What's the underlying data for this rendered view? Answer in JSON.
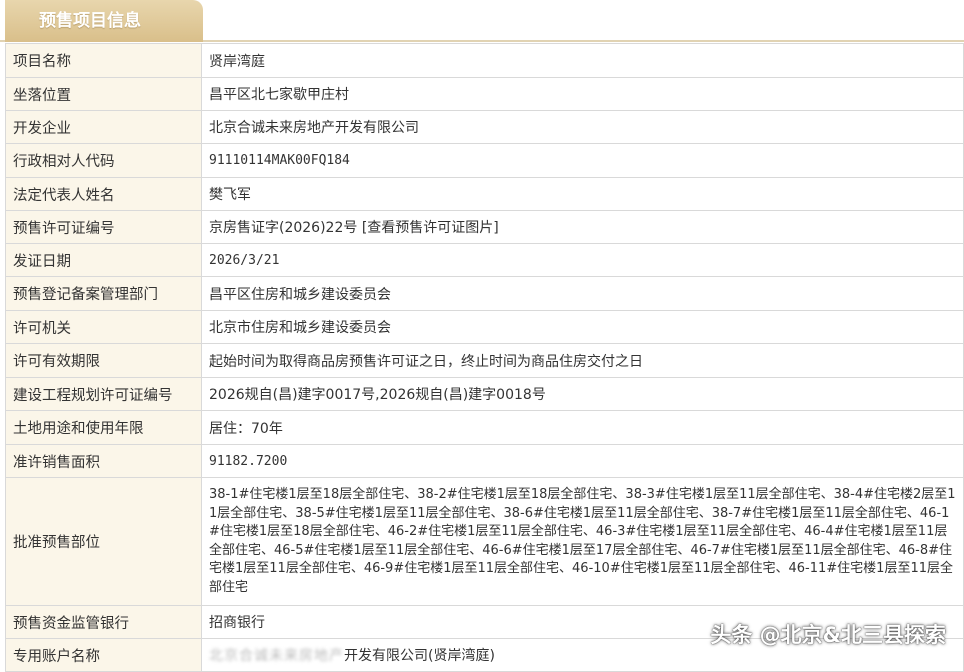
{
  "header": {
    "tab_title": "预售项目信息"
  },
  "rows": [
    {
      "label": "项目名称",
      "value": "贤岸湾庭"
    },
    {
      "label": "坐落位置",
      "value": "昌平区北七家歇甲庄村"
    },
    {
      "label": "开发企业",
      "value": "北京合诚未来房地产开发有限公司"
    },
    {
      "label": "行政相对人代码",
      "value": "91110114MAK00FQ184"
    },
    {
      "label": "法定代表人姓名",
      "value": "樊飞军"
    },
    {
      "label": "预售许可证编号",
      "value": "京房售证字(2026)22号",
      "link": "[查看预售许可证图片]"
    },
    {
      "label": "发证日期",
      "value": "2026/3/21"
    },
    {
      "label": "预售登记备案管理部门",
      "value": "昌平区住房和城乡建设委员会"
    },
    {
      "label": "许可机关",
      "value": "北京市住房和城乡建设委员会"
    },
    {
      "label": "许可有效期限",
      "value": "起始时间为取得商品房预售许可证之日，终止时间为商品住房交付之日"
    },
    {
      "label": "建设工程规划许可证编号",
      "value": "2026规自(昌)建字0017号,2026规自(昌)建字0018号"
    },
    {
      "label": "土地用途和使用年限",
      "value": "居住：70年"
    },
    {
      "label": "准许销售面积",
      "value": "91182.7200"
    },
    {
      "label": "批准预售部位",
      "value": "38-1#住宅楼1层至18层全部住宅、38-2#住宅楼1层至18层全部住宅、38-3#住宅楼1层至11层全部住宅、38-4#住宅楼2层至11层全部住宅、38-5#住宅楼1层至11层全部住宅、38-6#住宅楼1层至11层全部住宅、38-7#住宅楼1层至11层全部住宅、46-1#住宅楼1层至18层全部住宅、46-2#住宅楼1层至11层全部住宅、46-3#住宅楼1层至11层全部住宅、46-4#住宅楼1层至11层全部住宅、46-5#住宅楼1层至11层全部住宅、46-6#住宅楼1层至17层全部住宅、46-7#住宅楼1层至11层全部住宅、46-8#住宅楼1层至11层全部住宅、46-9#住宅楼1层至11层全部住宅、46-10#住宅楼1层至11层全部住宅、46-11#住宅楼1层至11层全部住宅"
    },
    {
      "label": "预售资金监管银行",
      "value": "招商银行"
    },
    {
      "label": "专用账户名称",
      "value_blur": "北京合诚未来房地产",
      "value": "开发有限公司(贤岸湾庭)"
    }
  ],
  "watermark": "头条 @北京&北三县探索"
}
